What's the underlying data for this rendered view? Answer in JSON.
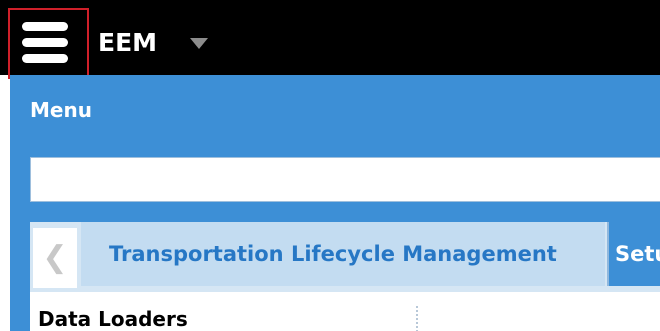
{
  "header": {
    "menu_icon": "hamburger-menu-icon",
    "app_title": "EEM",
    "dropdown_icon": "caret-down-icon"
  },
  "menu": {
    "title": "Menu",
    "search": {
      "value": "",
      "placeholder": ""
    },
    "tabs": {
      "scroll_left_icon": "chevron-left-icon",
      "items": [
        {
          "label": "Transportation Lifecycle Management",
          "active": true
        },
        {
          "label": "Setu",
          "active": false
        }
      ]
    },
    "section_heading": "Data Loaders"
  },
  "colors": {
    "topbar": "#000000",
    "panel": "#3d8fd6",
    "active_tab_text": "#2677c5",
    "highlight_border": "#d0202a"
  }
}
